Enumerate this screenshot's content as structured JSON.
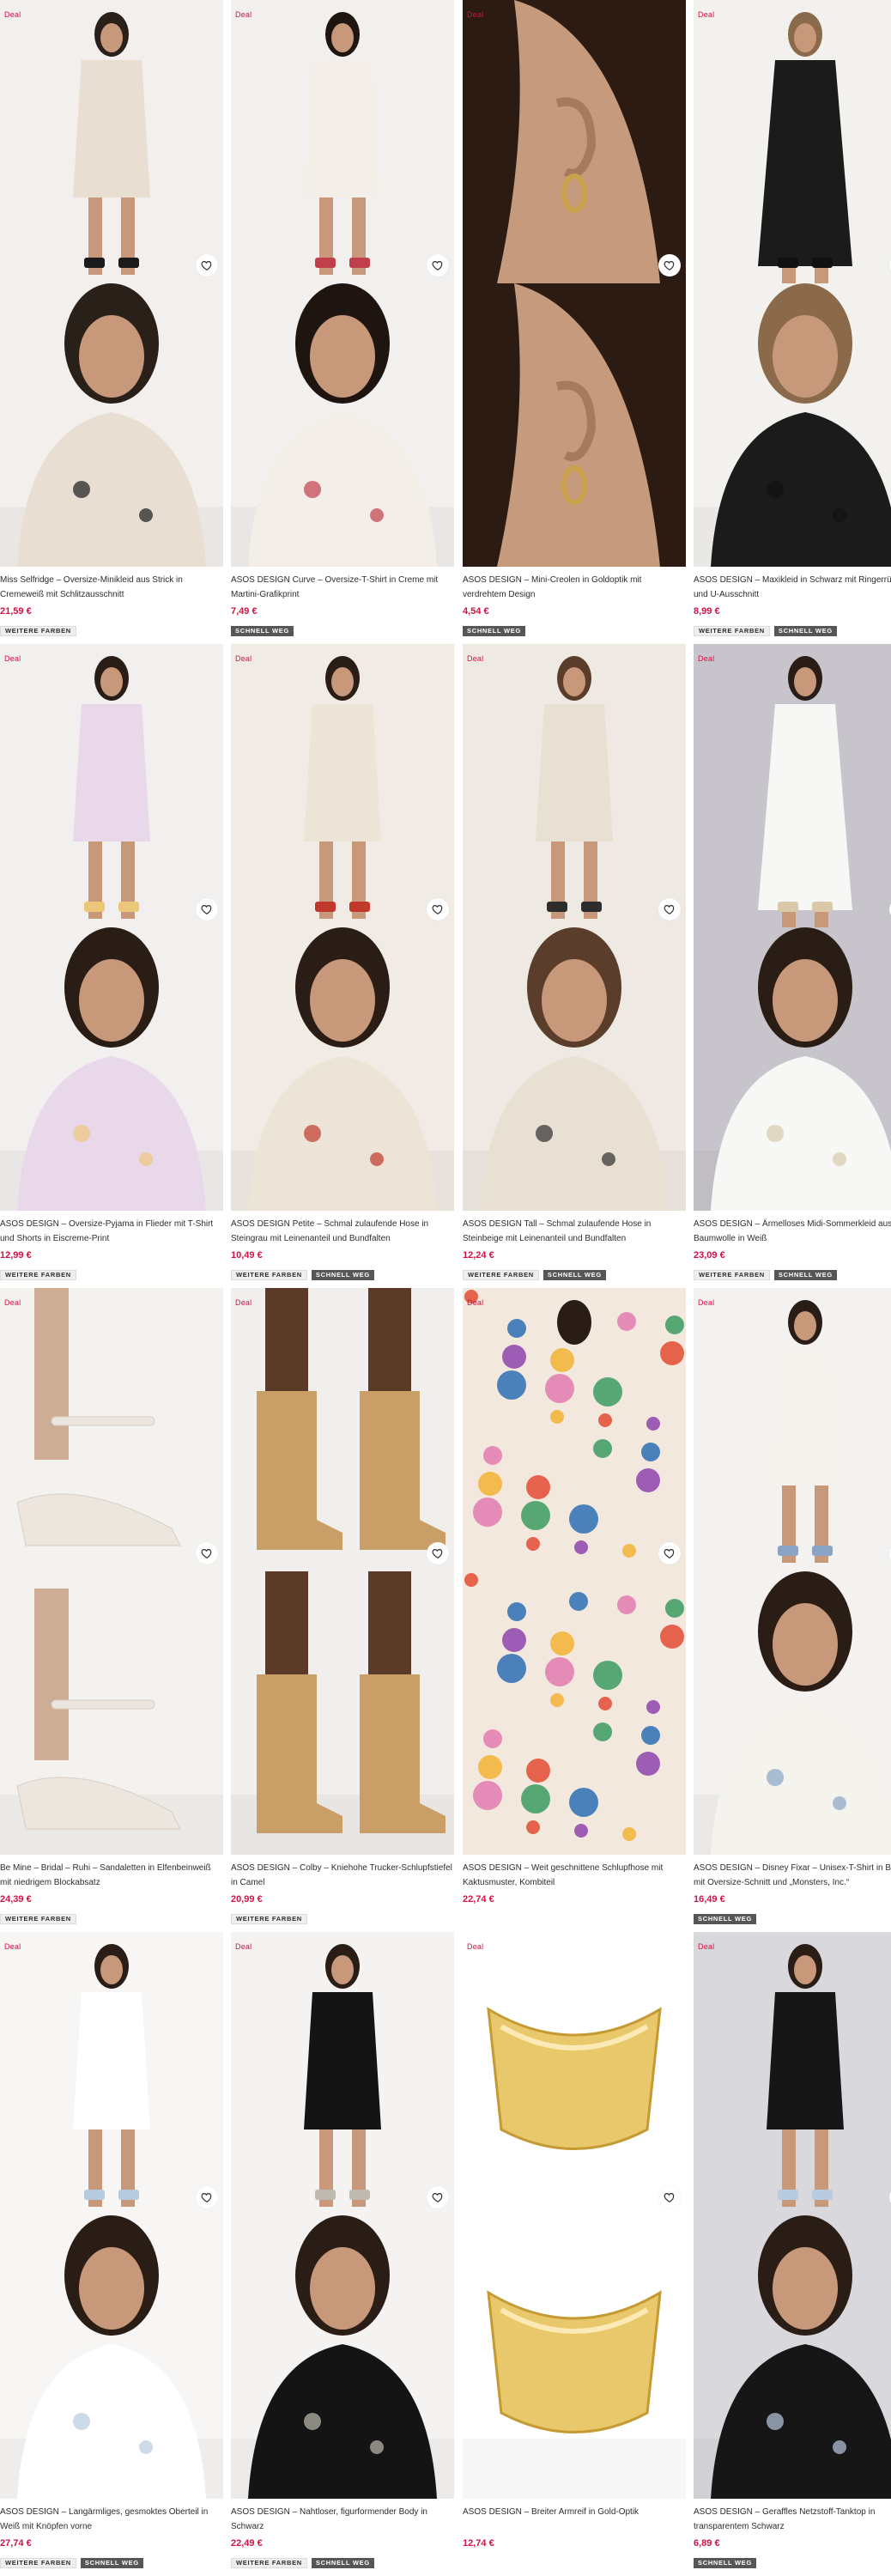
{
  "labels": {
    "deal": "Deal",
    "more_colors": "WEITERE FARBEN",
    "selling_fast": "SCHNELL WEG"
  },
  "colors": {
    "sale_price": "#d01345",
    "deal_text": "#d01345",
    "badge_dark": "#565656"
  },
  "products": [
    {
      "title": "Miss Selfridge – Oversize-Minikleid aus Strick in Cremeweiß mit Schlitzausschnitt",
      "price": "21,59 €",
      "deal": true,
      "more_colors": true,
      "selling_fast": false
    },
    {
      "title": "ASOS DESIGN Curve – Oversize-T-Shirt in Creme mit Martini-Grafikprint",
      "price": "7,49 €",
      "deal": true,
      "more_colors": false,
      "selling_fast": true
    },
    {
      "title": "ASOS DESIGN – Mini-Creolen in Goldoptik mit verdrehtem Design",
      "price": "4,54 €",
      "deal": true,
      "more_colors": false,
      "selling_fast": true
    },
    {
      "title": "ASOS DESIGN – Maxikleid in Schwarz mit Ringerrücken und U-Ausschnitt",
      "price": "8,99 €",
      "deal": true,
      "more_colors": true,
      "selling_fast": true
    },
    {
      "title": "ASOS DESIGN – Oversize-Pyjama in Flieder mit T-Shirt und Shorts in Eiscreme-Print",
      "price": "12,99 €",
      "deal": true,
      "more_colors": true,
      "selling_fast": false
    },
    {
      "title": "ASOS DESIGN Petite – Schmal zulaufende Hose in Steingrau mit Leinenanteil und Bundfalten",
      "price": "10,49 €",
      "deal": true,
      "more_colors": true,
      "selling_fast": true
    },
    {
      "title": "ASOS DESIGN Tall – Schmal zulaufende Hose in Steinbeige mit Leinenanteil und Bundfalten",
      "price": "12,24 €",
      "deal": true,
      "more_colors": true,
      "selling_fast": true
    },
    {
      "title": "ASOS DESIGN – Ärmelloses Midi-Sommerkleid aus Baumwolle in Weiß",
      "price": "23,09 €",
      "deal": true,
      "more_colors": true,
      "selling_fast": true
    },
    {
      "title": "Be Mine – Bridal – Ruhi – Sandaletten in Elfenbeinweiß mit niedrigem Blockabsatz",
      "price": "24,39 €",
      "deal": true,
      "more_colors": true,
      "selling_fast": false
    },
    {
      "title": "ASOS DESIGN – Colby – Kniehohe Trucker-Schlupfstiefel in Camel",
      "price": "20,99 €",
      "deal": true,
      "more_colors": true,
      "selling_fast": false
    },
    {
      "title": "ASOS DESIGN – Weit geschnittene Schlupfhose mit Kaktusmuster, Kombiteil",
      "price": "22,74 €",
      "deal": true,
      "more_colors": false,
      "selling_fast": false
    },
    {
      "title": "ASOS DESIGN – Disney Fixar – Unisex-T-Shirt in Beige mit Oversize-Schnitt und „Monsters, Inc.“",
      "price": "16,49 €",
      "deal": true,
      "more_colors": false,
      "selling_fast": true
    },
    {
      "title": "ASOS DESIGN – Langärmliges, gesmoktes Oberteil in Weiß mit Knöpfen vorne",
      "price": "27,74 €",
      "deal": true,
      "more_colors": true,
      "selling_fast": true
    },
    {
      "title": "ASOS DESIGN – Nahtloser, figurformender Body in Schwarz",
      "price": "22,49 €",
      "deal": true,
      "more_colors": true,
      "selling_fast": true
    },
    {
      "title": "ASOS DESIGN – Breiter Armreif in Gold-Optik",
      "price": "12,74 €",
      "deal": true,
      "more_colors": false,
      "selling_fast": false
    },
    {
      "title": "ASOS DESIGN – Geraffles Netzstoff-Tanktop in transparentem Schwarz",
      "price": "6,89 €",
      "deal": true,
      "more_colors": false,
      "selling_fast": true
    }
  ]
}
